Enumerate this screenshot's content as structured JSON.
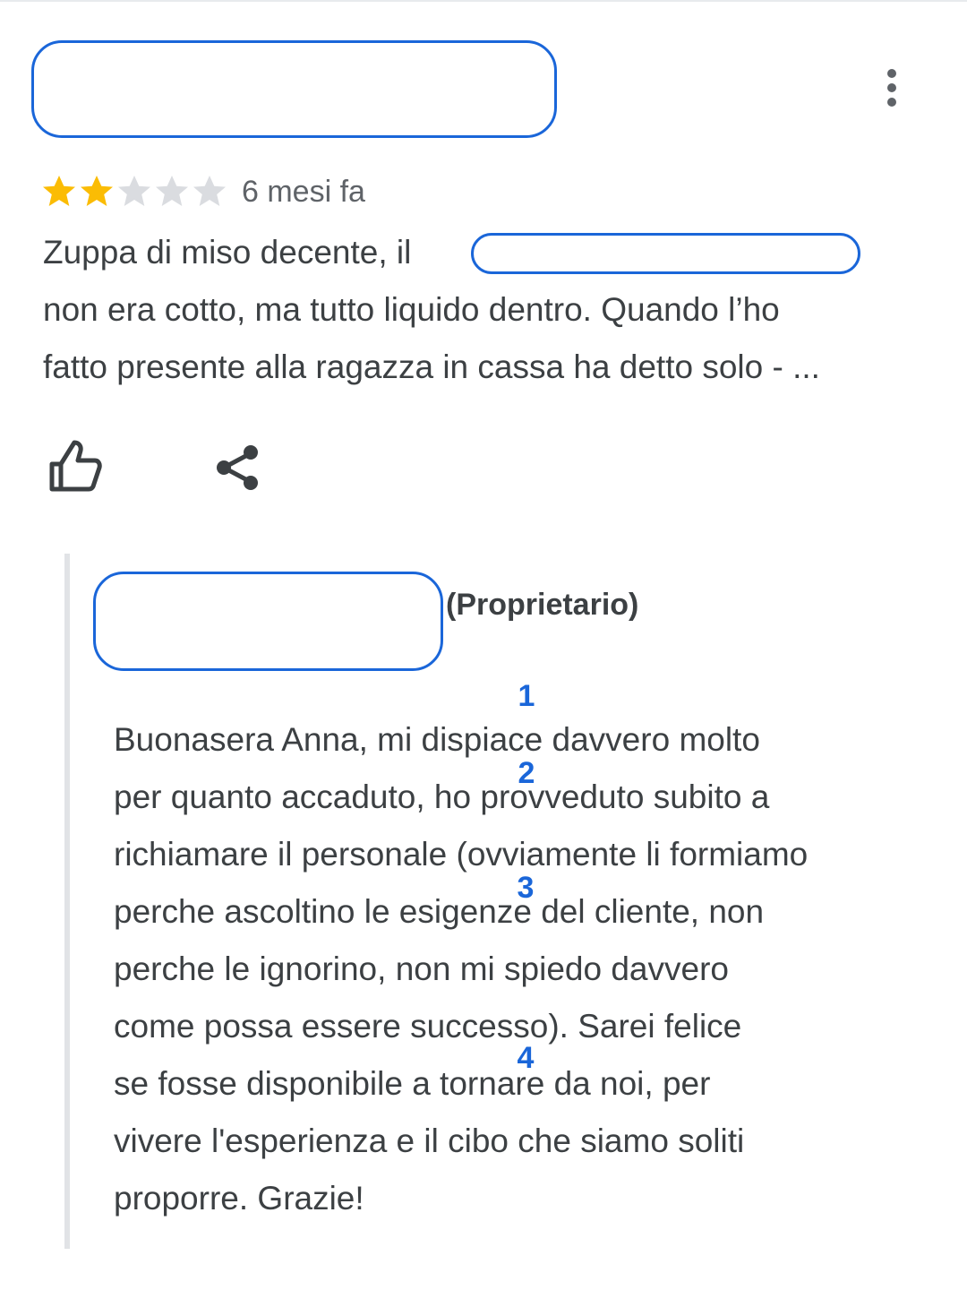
{
  "review": {
    "rating": 2,
    "max_rating": 5,
    "star_colors": {
      "filled": "#fbbc04",
      "empty": "#dadce0"
    },
    "time": "6 mesi fa",
    "text_lines": [
      "Zuppa di miso decente, il",
      "non era cotto, ma tutto liquido dentro. Quando l’ho",
      "fatto presente alla ragazza in cassa ha detto solo - ..."
    ],
    "actions": {
      "like_icon": "thumb-up-icon",
      "share_icon": "share-icon",
      "more_icon": "more-vert-icon"
    }
  },
  "reply": {
    "owner_label": "(Proprietario)",
    "text_lines": [
      "Buonasera Anna, mi dispiace davvero molto",
      "per quanto accaduto, ho provveduto subito a",
      "richiamare il personale (ovviamente li formiamo",
      "perche ascoltino le esigenze del cliente, non",
      "perche le ignorino, non mi spiedo davvero",
      "come possa essere successo). Sarei felice",
      "se fosse disponibile a tornare da noi, per",
      "vivere l'esperienza e il cibo che siamo soliti",
      "proporre. Grazie!"
    ]
  },
  "annotations": {
    "markers": [
      "1",
      "2",
      "3",
      "4"
    ],
    "color": "#1a66d9"
  },
  "colors": {
    "redaction_border": "#1a66d9",
    "text": "#3c4043",
    "secondary_text": "#5f6368"
  }
}
